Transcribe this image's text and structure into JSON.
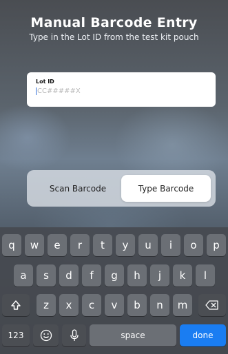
{
  "header": {
    "title": "Manual Barcode Entry",
    "subtitle": "Type in the Lot ID from the test kit pouch"
  },
  "lot_field": {
    "label": "Lot ID",
    "placeholder": "CC#####X",
    "value": ""
  },
  "mode_switch": {
    "options": [
      "Scan Barcode",
      "Type Barcode"
    ],
    "selected": "Type Barcode"
  },
  "keyboard": {
    "row1": [
      "q",
      "w",
      "e",
      "r",
      "t",
      "y",
      "u",
      "i",
      "o",
      "p"
    ],
    "row2": [
      "a",
      "s",
      "d",
      "f",
      "g",
      "h",
      "j",
      "k",
      "l"
    ],
    "row3": [
      "z",
      "x",
      "c",
      "v",
      "b",
      "n",
      "m"
    ],
    "numbers_label": "123",
    "space_label": "space",
    "done_label": "done",
    "icons": [
      "shift-icon",
      "backspace-icon",
      "emoji-icon",
      "microphone-icon"
    ],
    "colors": {
      "key": "#6b6f75",
      "function_key": "#4b4e53",
      "done": "#1a7df2"
    }
  }
}
